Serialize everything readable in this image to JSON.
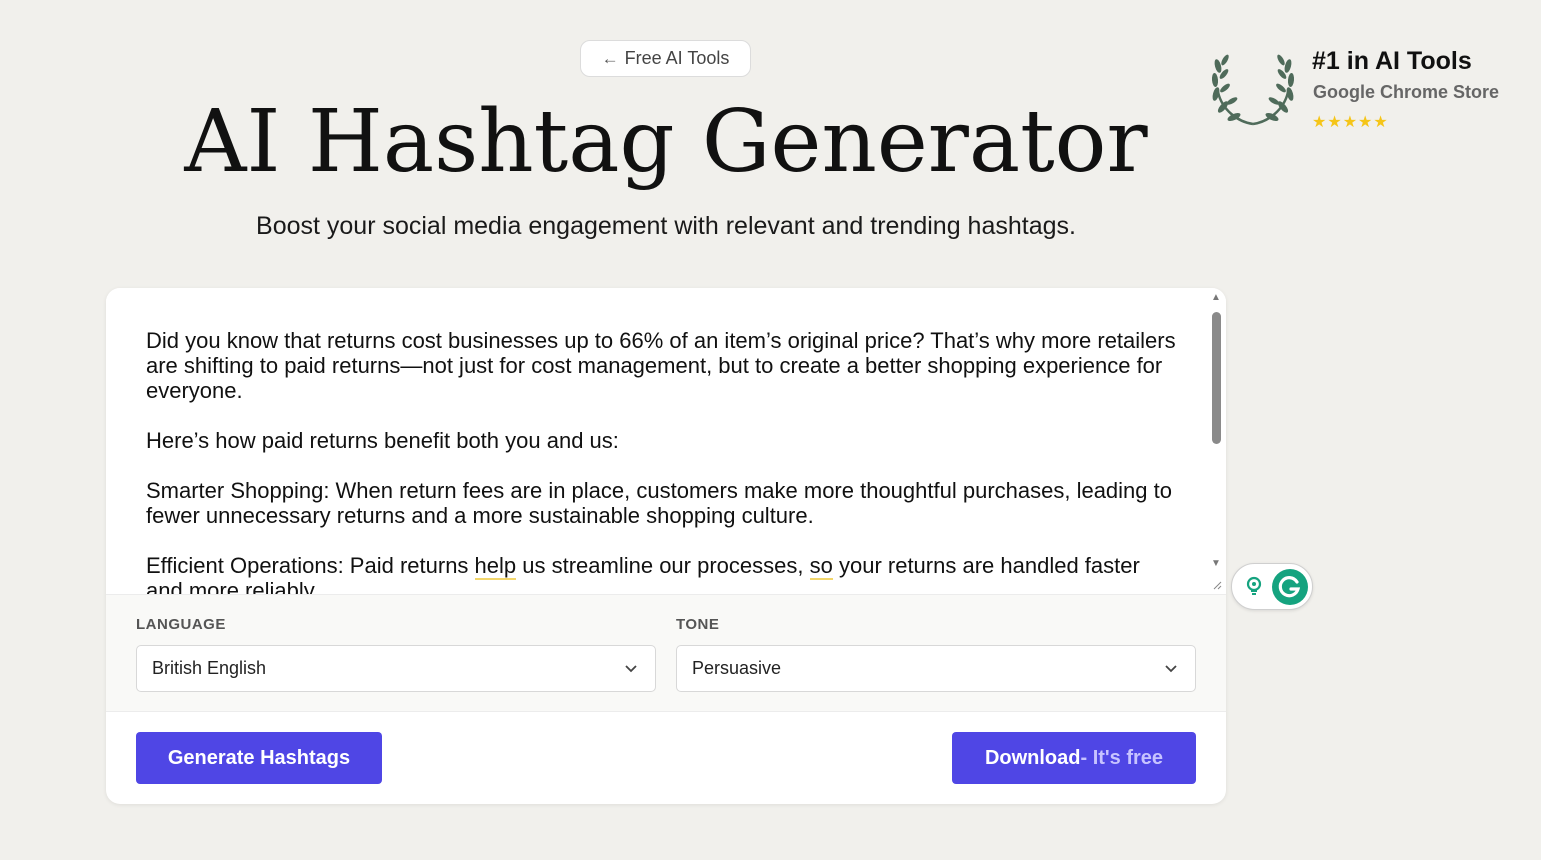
{
  "nav": {
    "back_label": "Free AI Tools",
    "back_icon": "arrow-left-icon"
  },
  "hero": {
    "title": "AI Hashtag Generator",
    "subtitle": "Boost your social media engagement with relevant and trending hashtags."
  },
  "badge": {
    "title": "#1 in AI Tools",
    "subtitle": "Google Chrome Store",
    "stars": "★★★★★",
    "rating": 5,
    "star_color": "#f5c518",
    "laurel_color": "#4f6b5a"
  },
  "editor": {
    "paragraphs": [
      "Did you know that returns cost businesses up to 66% of an item’s original price? That’s why more retailers are shifting to paid returns—not just for cost management, but to create a better shopping experience for everyone.",
      "Here’s how paid returns benefit both you and us:",
      "Smarter Shopping: When return fees are in place, customers make more thoughtful purchases, leading to fewer unnecessary returns and a more sustainable shopping culture."
    ],
    "para4": {
      "part1": "Efficient Operations: Paid returns ",
      "word1": "help",
      "part2": " us streamline our processes, ",
      "word2": "so",
      "part3": " your returns are handled faster and more reliably."
    }
  },
  "options": {
    "language": {
      "label": "LANGUAGE",
      "value": "British English"
    },
    "tone": {
      "label": "TONE",
      "value": "Persuasive"
    }
  },
  "actions": {
    "generate_label": "Generate Hashtags",
    "download_label": "Download",
    "download_suffix": "- It's free",
    "accent": "#4f46e5"
  },
  "grammarly": {
    "icons": [
      "lightbulb-icon",
      "grammarly-icon"
    ],
    "brand_color": "#15a37f"
  }
}
